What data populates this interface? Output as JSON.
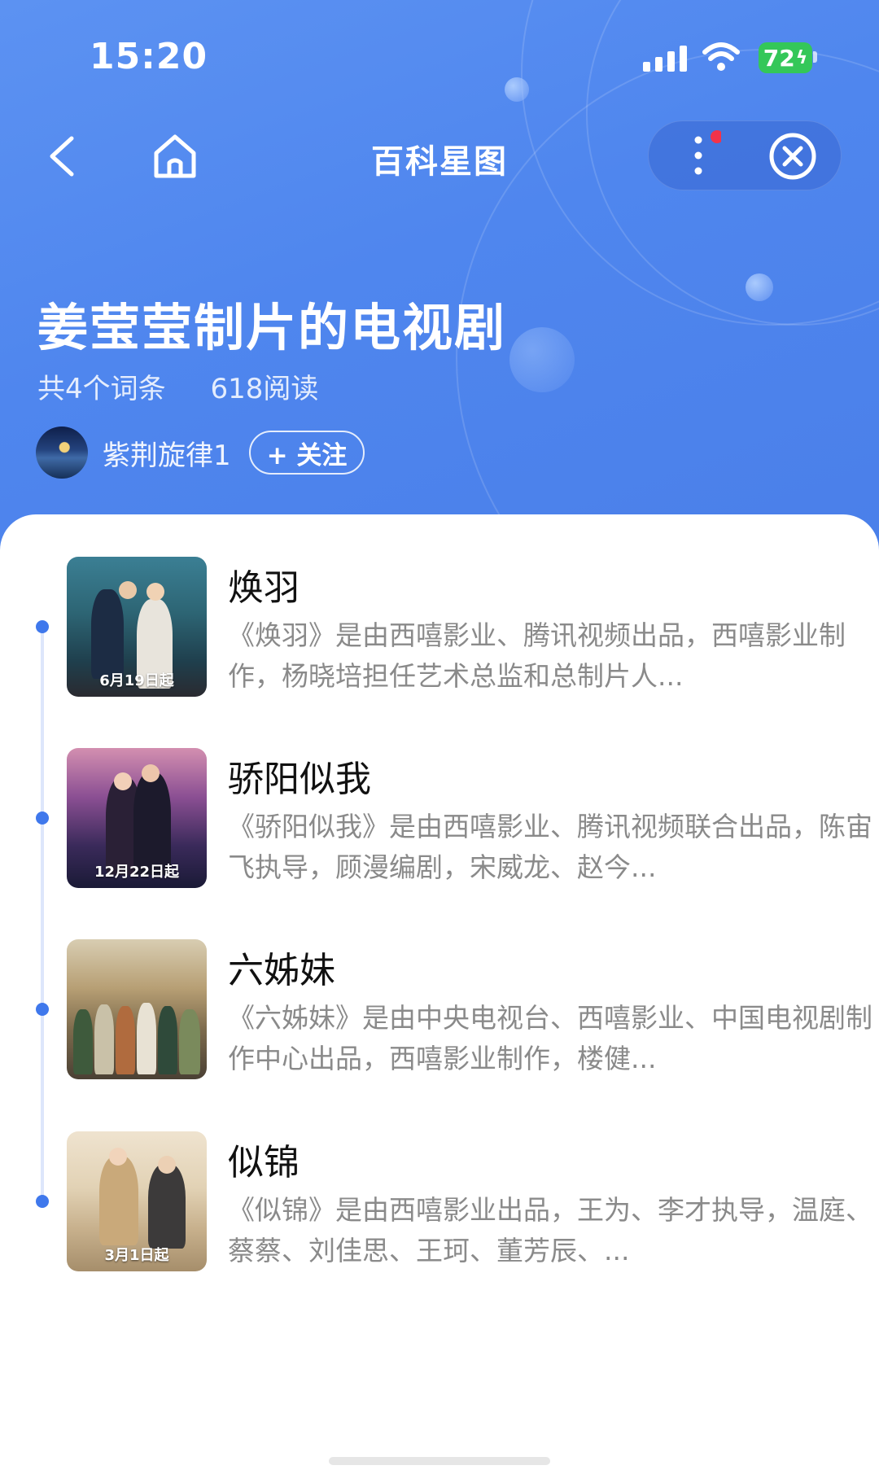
{
  "status_bar": {
    "time": "15:20",
    "battery": "72"
  },
  "nav": {
    "title": "百科星图"
  },
  "header": {
    "title": "姜莹莹制片的电视剧",
    "entry_count": "共4个词条",
    "reads": "618阅读",
    "author": "紫荆旋律1",
    "follow_label": "+ 关注"
  },
  "items": [
    {
      "title": "焕羽",
      "desc": "《焕羽》是由西嘻影业、腾讯视频出品，西嘻影业制作，杨晓培担任艺术总监和总制片人...",
      "poster_tag": "6月19日起"
    },
    {
      "title": "骄阳似我",
      "desc": "《骄阳似我》是由西嘻影业、腾讯视频联合出品，陈宙飞执导，顾漫编剧，宋威龙、赵今...",
      "poster_tag": "12月22日起"
    },
    {
      "title": "六姊妹",
      "desc": "《六姊妹》是由中央电视台、西嘻影业、中国电视剧制作中心出品，西嘻影业制作，楼健...",
      "poster_tag": ""
    },
    {
      "title": "似锦",
      "desc": "《似锦》是由西嘻影业出品，王为、李才执导，温庭、蔡蔡、刘佳思、王珂、董芳辰、...",
      "poster_tag": "3月1日起"
    }
  ],
  "colors": {
    "header_blue": "#4f86ee",
    "timeline_dot": "#3f78ec",
    "battery_green": "#34c759"
  }
}
